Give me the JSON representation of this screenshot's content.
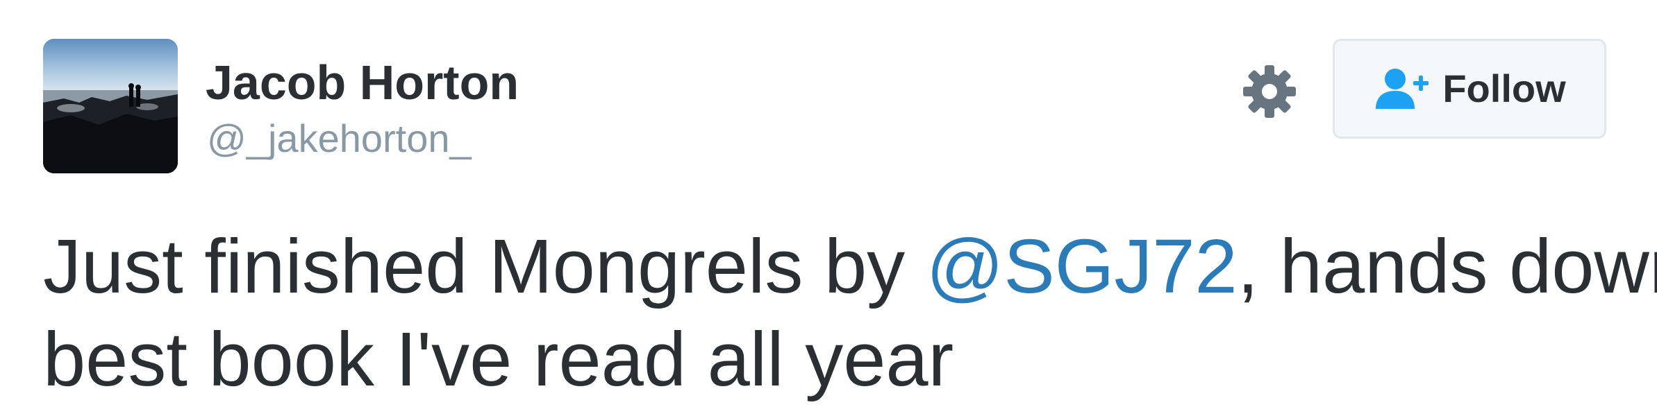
{
  "user": {
    "name": "Jacob Horton",
    "handle": "@_jakehorton_"
  },
  "actions": {
    "settings_icon": "gear-icon",
    "follow_icon": "person-plus-icon",
    "follow_label": "Follow"
  },
  "tweet": {
    "text_before_mention": "Just finished Mongrels by ",
    "mention": "@SGJ72",
    "text_after_mention": ", hands down",
    "line2": "best book I've read all year"
  },
  "colors": {
    "text": "#292f33",
    "handle": "#8899a6",
    "mention": "#2b7bb9",
    "gear": "#66757f",
    "follow_icon": "#1da1f2",
    "button_border": "#e1e8ed",
    "button_bg": "#f5f8fa"
  }
}
